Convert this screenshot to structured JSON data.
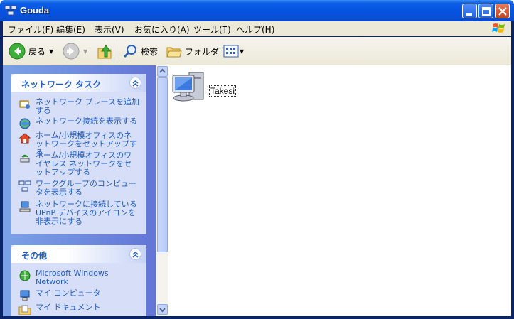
{
  "window": {
    "title": "Gouda"
  },
  "menu": {
    "items": [
      "ファイル(F)",
      "編集(E)",
      "表示(V)",
      "お気に入り(A)",
      "ツール(T)",
      "ヘルプ(H)"
    ]
  },
  "toolbar": {
    "back_label": "戻る",
    "search_label": "検索",
    "folders_label": "フォルダ"
  },
  "taskpane": {
    "network_tasks": {
      "title": "ネットワーク タスク",
      "items": [
        {
          "label": "ネットワーク プレースを追加する",
          "icon": "add-network-place-icon"
        },
        {
          "label": "ネットワーク接続を表示する",
          "icon": "network-connections-icon"
        },
        {
          "label": "ホーム/小規模オフィスのネットワークをセットアップする",
          "icon": "home-network-setup-icon"
        },
        {
          "label": "ホーム/小規模オフィスのワイヤレス ネットワークをセットアップする",
          "icon": "wireless-network-icon"
        },
        {
          "label": "ワークグループのコンピュータを表示する",
          "icon": "workgroup-computers-icon"
        },
        {
          "label": "ネットワークに接続している UPnP デバイスのアイコンを非表示にする",
          "icon": "upnp-device-icon"
        }
      ]
    },
    "other_places": {
      "title": "その他",
      "items": [
        {
          "label": "Microsoft Windows Network",
          "icon": "windows-network-icon"
        },
        {
          "label": "マイ コンピュータ",
          "icon": "my-computer-icon"
        },
        {
          "label": "マイ ドキュメント",
          "icon": "my-documents-icon"
        }
      ]
    }
  },
  "files": [
    {
      "name": "Takesi",
      "icon": "computer-icon"
    }
  ]
}
